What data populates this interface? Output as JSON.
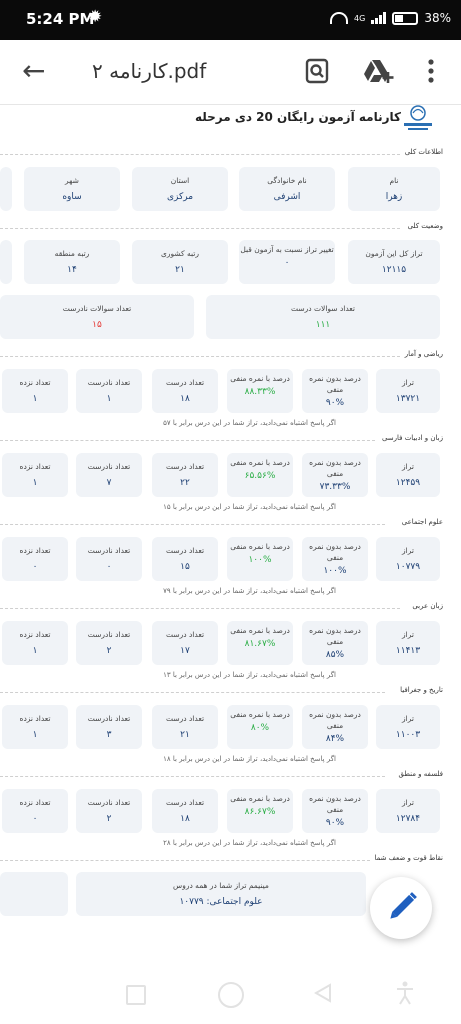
{
  "status": {
    "time": "5:24 PM",
    "network": "4G",
    "battery": "38%"
  },
  "appbar": {
    "title": "کارنامه ۲.pdf"
  },
  "doc": {
    "title": "کارنامه آزمون رایگان 20 دی مرحله",
    "general_section": "اطلاعات کلی",
    "general": [
      {
        "label": "نام",
        "value": "زهرا"
      },
      {
        "label": "نام خانوادگی",
        "value": "اشرفی"
      },
      {
        "label": "استان",
        "value": "مرکزی"
      },
      {
        "label": "شهر",
        "value": "ساوه"
      }
    ],
    "status_section": "وضعیت کلی",
    "status_cards": [
      {
        "label": "تراز کل این آزمون",
        "value": "۱۲۱۱۵"
      },
      {
        "label": "تغییر تراز نسبت به آزمون قبل",
        "value": "۰"
      },
      {
        "label": "رتبه کشوری",
        "value": "۲۱"
      },
      {
        "label": "رتبه منطقه",
        "value": "۱۴"
      }
    ],
    "counts": [
      {
        "label": "تعداد سوالات درست",
        "value": "۱۱۱"
      },
      {
        "label": "تعداد سوالات نادرست",
        "value": "۱۵"
      }
    ],
    "labels": {
      "taraz": "تراز",
      "pct_no_neg": "درصد بدون نمره منفی",
      "pct_neg": "درصد با نمره منفی",
      "correct": "تعداد درست",
      "wrong": "تعداد نادرست",
      "blank": "تعداد نزده"
    },
    "subjects": [
      {
        "name": "ریاضی و آمار",
        "taraz": "۱۳۷۲۱",
        "pct_no_neg": "۹۰%",
        "pct_neg": "۸۸.۳۳%",
        "correct": "۱۸",
        "wrong": "۱",
        "blank": "۱",
        "note": "اگر پاسخ اشتباه نمی‌دادید، تراز شما در این درس برابر با ۵۷"
      },
      {
        "name": "زبان و ادبیات فارسی",
        "taraz": "۱۲۴۵۹",
        "pct_no_neg": "۷۳.۳۳%",
        "pct_neg": "۶۵.۵۶%",
        "correct": "۲۲",
        "wrong": "۷",
        "blank": "۱",
        "note": "اگر پاسخ اشتباه نمی‌دادید، تراز شما در این درس برابر با ۱۵"
      },
      {
        "name": "علوم اجتماعی",
        "taraz": "۱۰۷۷۹",
        "pct_no_neg": "۱۰۰%",
        "pct_neg": "۱۰۰%",
        "correct": "۱۵",
        "wrong": "۰",
        "blank": "۰",
        "note": "اگر پاسخ اشتباه نمی‌دادید، تراز شما در این درس برابر با ۷۹"
      },
      {
        "name": "زبان عربی",
        "taraz": "۱۱۴۱۳",
        "pct_no_neg": "۸۵%",
        "pct_neg": "۸۱.۶۷%",
        "correct": "۱۷",
        "wrong": "۲",
        "blank": "۱",
        "note": "اگر پاسخ اشتباه نمی‌دادید، تراز شما در این درس برابر با ۱۳"
      },
      {
        "name": "تاریخ و جغرافیا",
        "taraz": "۱۱۰۰۳",
        "pct_no_neg": "۸۴%",
        "pct_neg": "۸۰%",
        "correct": "۲۱",
        "wrong": "۳",
        "blank": "۱",
        "note": "اگر پاسخ اشتباه نمی‌دادید، تراز شما در این درس برابر با ۱۸"
      },
      {
        "name": "فلسفه و منطق",
        "taraz": "۱۲۷۸۴",
        "pct_no_neg": "۹۰%",
        "pct_neg": "۸۶.۶۷%",
        "correct": "۱۸",
        "wrong": "۲",
        "blank": "۰",
        "note": "اگر پاسخ اشتباه نمی‌دادید، تراز شما در این درس برابر با ۲۸"
      }
    ],
    "strengths_section": "نقاط قوت و ضعف شما",
    "min_card": {
      "label": "مینیمم تراز شما در همه دروس",
      "value": "علوم اجتماعی: ۱۰۷۷۹"
    }
  },
  "colors": {
    "accent": "#1d3f73",
    "green": "#2cae47",
    "red": "#e53935",
    "fab_icon": "#1f5fbf"
  },
  "icons": [
    "gear-icon",
    "wifi-icon",
    "signal-icon",
    "battery-icon",
    "back-arrow-icon",
    "search-document-icon",
    "drive-add-icon",
    "more-vert-icon",
    "edit-pencil-icon",
    "nav-recents-icon",
    "nav-home-icon",
    "nav-back-icon",
    "nav-accessibility-icon"
  ]
}
